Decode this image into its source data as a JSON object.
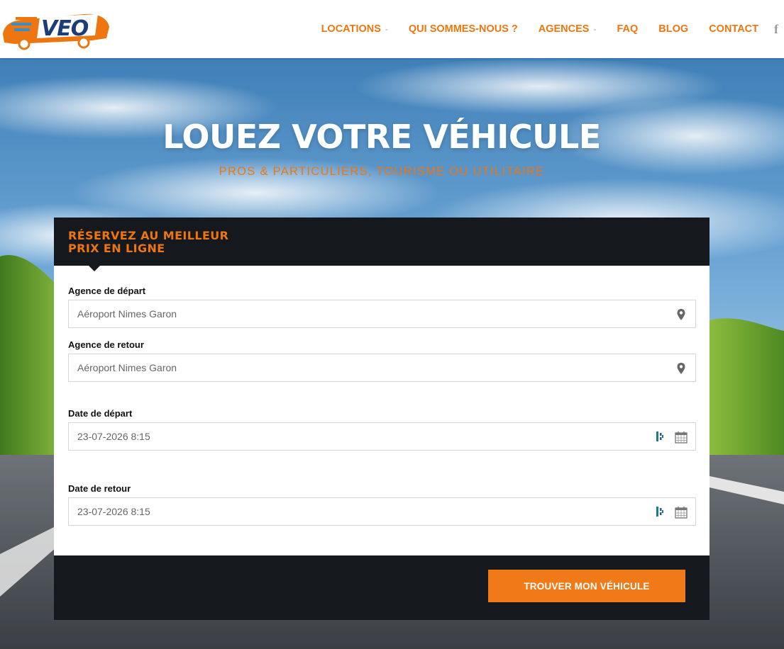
{
  "brand": {
    "logo_text": "VEO",
    "accent": "#ee7611",
    "dark": "#15181d"
  },
  "nav": {
    "items": [
      {
        "label": "LOCATIONS",
        "has_dropdown": true
      },
      {
        "label": "QUI SOMMES-NOUS ?",
        "has_dropdown": false
      },
      {
        "label": "AGENCES",
        "has_dropdown": true
      },
      {
        "label": "FAQ",
        "has_dropdown": false
      },
      {
        "label": "BLOG",
        "has_dropdown": false
      },
      {
        "label": "CONTACT",
        "has_dropdown": false
      }
    ],
    "caret": "-",
    "social_icon": "facebook-icon",
    "social_glyph": "f"
  },
  "hero": {
    "title": "LOUEZ VOTRE VÉHICULE",
    "subtitle": "PROS & PARTICULIERS, TOURISME OU UTILITAIRE"
  },
  "booking": {
    "heading": "RÉSERVEZ AU MEILLEUR PRIX EN LIGNE",
    "pickup_agency": {
      "label": "Agence de départ",
      "value": "Aéroport Nimes Garon",
      "icon": "map-marker-icon"
    },
    "return_agency": {
      "label": "Agence de retour",
      "value": "Aéroport Nimes Garon",
      "icon": "map-marker-icon"
    },
    "pickup_date": {
      "label": "Date de départ",
      "value": "23-07-2026 8:15",
      "icon": "calendar-icon"
    },
    "return_date": {
      "label": "Date de retour",
      "value": "23-07-2026 8:15",
      "icon": "calendar-icon"
    },
    "submit_label": "TROUVER MON VÉHICULE"
  }
}
